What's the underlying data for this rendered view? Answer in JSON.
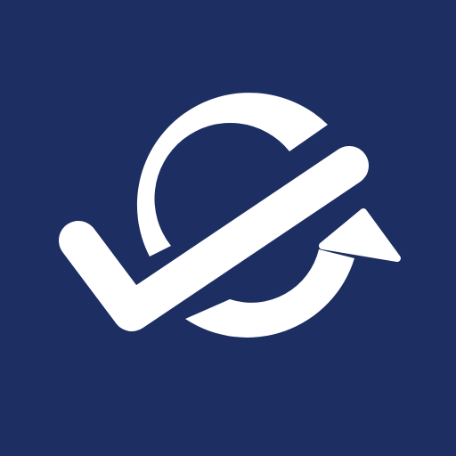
{
  "icon": {
    "name": "sync-check-icon",
    "background_color": "#1c2e62",
    "foreground_color": "#ffffff"
  }
}
